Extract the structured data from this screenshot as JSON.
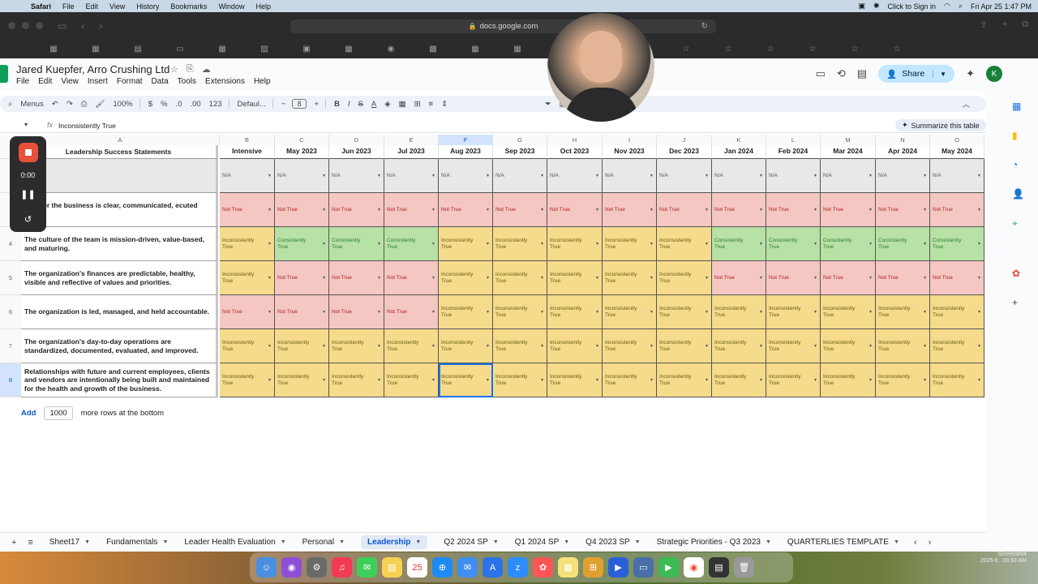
{
  "menubar": {
    "app": "Safari",
    "items": [
      "File",
      "Edit",
      "View",
      "History",
      "Bookmarks",
      "Window",
      "Help"
    ],
    "click_to_sign_in": "Click to Sign in",
    "clock": "Fri Apr 25  1:47 PM"
  },
  "browser": {
    "url": "docs.google.com"
  },
  "doc": {
    "title": "Jared Kuepfer, Arro Crushing Ltd",
    "menus": [
      "File",
      "Edit",
      "View",
      "Insert",
      "Format",
      "Data",
      "Tools",
      "Extensions",
      "Help"
    ],
    "share_label": "Share",
    "avatar_letter": "K"
  },
  "toolbar": {
    "menus_label": "Menus",
    "zoom": "100%",
    "currency": "$",
    "percent": "%",
    "dec_less": ".0",
    "dec_more": ".00",
    "number_format": "123",
    "font": "Defaul...",
    "font_size": "8"
  },
  "formula_bar": {
    "value": "Inconsistently True",
    "summarize_label": "Summarize this table"
  },
  "grid": {
    "column_letters": [
      "A",
      "B",
      "C",
      "D",
      "E",
      "F",
      "G",
      "H",
      "I",
      "J",
      "K",
      "L",
      "M",
      "N",
      "O"
    ],
    "header_label": "Leadership Success Statements",
    "months": [
      "Intensive",
      "May 2023",
      "Jun 2023",
      "Jul 2023",
      "Aug 2023",
      "Sep 2023",
      "Oct 2023",
      "Nov 2023",
      "Dec 2023",
      "Jan 2024",
      "Feb 2024",
      "Mar 2024",
      "Apr 2024",
      "May 2024"
    ],
    "rows": [
      {
        "num": "",
        "statement": "",
        "values": [
          "N/A",
          "N/A",
          "N/A",
          "N/A",
          "N/A",
          "N/A",
          "N/A",
          "N/A",
          "N/A",
          "N/A",
          "N/A",
          "N/A",
          "N/A",
          "N/A"
        ]
      },
      {
        "num": "",
        "statement": "sion for the business is clear, communicated, ecuted upon.",
        "values": [
          "Not True",
          "Not True",
          "Not True",
          "Not True",
          "Not True",
          "Not True",
          "Not True",
          "Not True",
          "Not True",
          "Not True",
          "Not True",
          "Not True",
          "Not True",
          "Not True"
        ]
      },
      {
        "num": "4",
        "statement": "The culture of the team is mission-driven, value-based, and maturing.",
        "values": [
          "Inconsistently True",
          "Consistently True",
          "Consistently True",
          "Consistently True",
          "Inconsistently True",
          "Inconsistently True",
          "Inconsistently True",
          "Inconsistently True",
          "Inconsistently True",
          "Consistently True",
          "Consistently True",
          "Consistently True",
          "Consistently True",
          "Consistently True"
        ]
      },
      {
        "num": "5",
        "statement": "The organization's finances are predictable, healthy, visible and reflective of values and priorities.",
        "values": [
          "Inconsistently True",
          "Not True",
          "Not True",
          "Not True",
          "Inconsistently True",
          "Inconsistently True",
          "Inconsistently True",
          "Inconsistently True",
          "Inconsistently True",
          "Not True",
          "Not True",
          "Not True",
          "Not True",
          "Not True"
        ]
      },
      {
        "num": "6",
        "statement": "The organization is led, managed, and held accountable.",
        "values": [
          "Not True",
          "Not True",
          "Not True",
          "Not True",
          "Inconsistently True",
          "Inconsistently True",
          "Inconsistently True",
          "Inconsistently True",
          "Inconsistently True",
          "Inconsistently True",
          "Inconsistently True",
          "Inconsistently True",
          "Inconsistently True",
          "Inconsistently True"
        ]
      },
      {
        "num": "7",
        "statement": "The organization's day-to-day operations are standardized, documented, evaluated, and improved.",
        "values": [
          "Inconsistently True",
          "Inconsistently True",
          "Inconsistently True",
          "Inconsistently True",
          "Inconsistently True",
          "Inconsistently True",
          "Inconsistently True",
          "Inconsistently True",
          "Inconsistently True",
          "Inconsistently True",
          "Inconsistently True",
          "Inconsistently True",
          "Inconsistently True",
          "Inconsistently True"
        ]
      },
      {
        "num": "8",
        "statement": "Relationships with future and current employees, clients and vendors are intentionally being built and maintained for the health and growth of the business.",
        "values": [
          "Inconsistently True",
          "Inconsistently True",
          "Inconsistently True",
          "Inconsistently True",
          "Inconsistently True",
          "Inconsistently True",
          "Inconsistently True",
          "Inconsistently True",
          "Inconsistently True",
          "Inconsistently True",
          "Inconsistently True",
          "Inconsistently True",
          "Inconsistently True",
          "Inconsistently True"
        ]
      }
    ],
    "add_label": "Add",
    "add_count": "1000",
    "add_suffix": "more rows at the bottom"
  },
  "sheet_tabs": [
    "Sheet17",
    "Fundamentals",
    "Leader Health Evaluation",
    "Personal",
    "Leadership",
    "Q2 2024 SP",
    "Q1 2024 SP",
    "Q4 2023 SP",
    "Strategic Priorities - Q3 2023",
    "QUARTERLIES TEMPLATE"
  ],
  "active_tab": "Leadership",
  "recorder": {
    "time": "0:00"
  },
  "desktop": {
    "screenshot_label": "Screenshot",
    "screenshot_date": "2025-0...09.53 AM"
  },
  "colors": {
    "not_true": "#f4c7c3",
    "consistently_true": "#b7e1a5",
    "inconsistently_true": "#f5db8b",
    "na": "#e8e8e8",
    "accent": "#0b57d0"
  }
}
